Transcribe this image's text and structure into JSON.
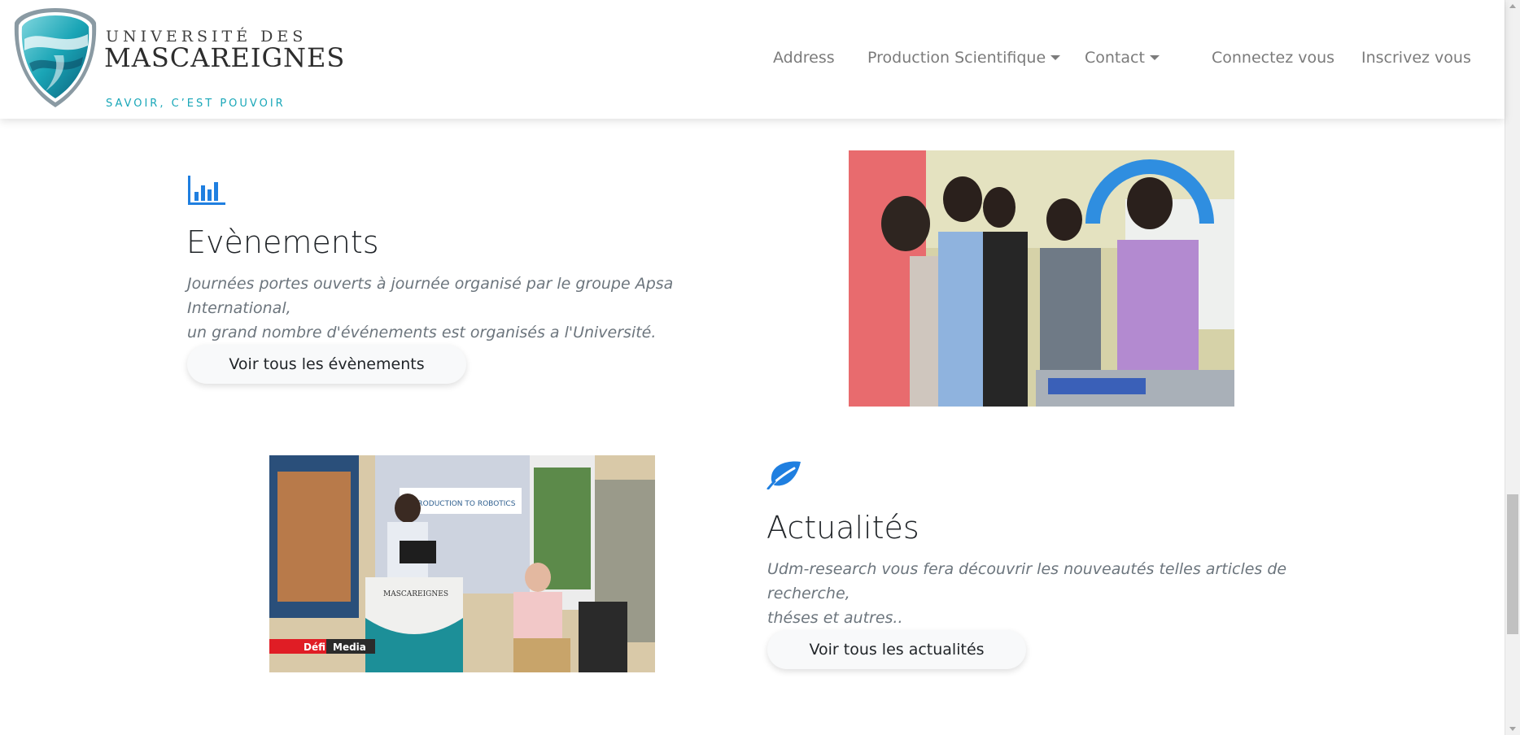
{
  "header": {
    "brand": {
      "line1": "UNIVERSITÉ DES",
      "line2": "MASCAREIGNES",
      "tagline": "SAVOIR, C’EST POUVOIR"
    },
    "nav": {
      "address": "Address",
      "production": "Production Scientifique",
      "contact": "Contact",
      "login": "Connectez vous",
      "register": "Inscrivez vous"
    }
  },
  "evenements": {
    "icon": "bar-chart-icon",
    "title": "Evènements",
    "description_line1": "Journées portes ouverts à journée organisé par le groupe Apsa International,",
    "description_line2": "un grand nombre d'événements est organisés a l'Université.",
    "button": "Voir tous les évènements"
  },
  "actualites": {
    "icon": "leaf-icon",
    "title": "Actualités",
    "description_line1": "Udm-research vous fera découvrir les nouveautés telles articles de recherche,",
    "description_line2": "théses et autres..",
    "button": "Voir tous les actualités"
  },
  "photos": {
    "robotics_slide_title": "INTRODUCTION TO ROBOTICS",
    "lectern_label": "MASCAREIGNES",
    "watermark_red": "Défi",
    "watermark_black": "Media"
  },
  "colors": {
    "accent": "#1f7fe0",
    "brand_teal": "#19a7b8",
    "nav_text": "#7b7b7b"
  }
}
